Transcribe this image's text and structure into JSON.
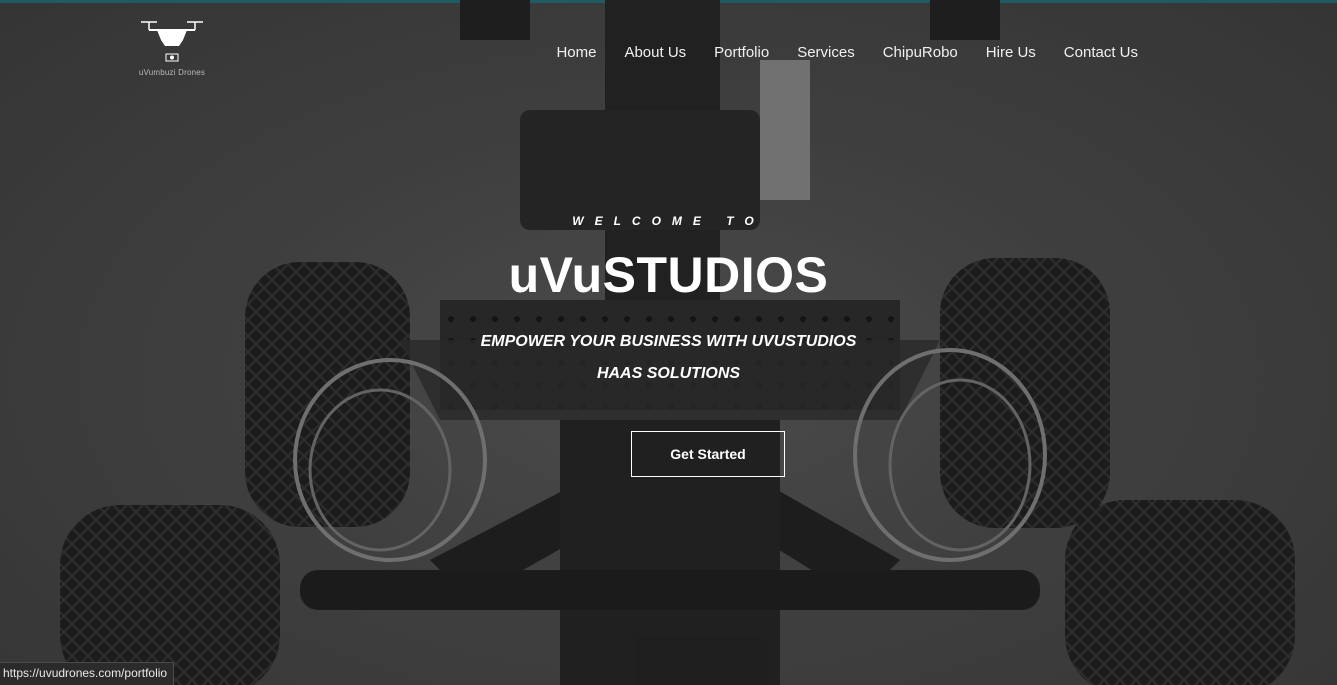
{
  "logo": {
    "caption": "uVumbuzi Drones",
    "icon": "drone-icon"
  },
  "nav": {
    "items": [
      {
        "label": "Home"
      },
      {
        "label": "About Us"
      },
      {
        "label": "Portfolio"
      },
      {
        "label": "Services"
      },
      {
        "label": "ChipuRobo"
      },
      {
        "label": "Hire Us"
      },
      {
        "label": "Contact Us"
      }
    ]
  },
  "hero": {
    "eyebrow": "WELCOME TO",
    "title": "uVuSTUDIOS",
    "tagline_line1": "EMPOWER YOUR BUSINESS WITH UVUSTUDIOS",
    "tagline_line2": "HAAS SOLUTIONS",
    "cta_label": "Get Started",
    "background": "robot-chassis-photo"
  },
  "status_bar": {
    "url": "https://uvudrones.com/portfolio"
  },
  "colors": {
    "accent_strip": "#1f6f78",
    "text": "#ffffff",
    "background": "#4a4a4a"
  }
}
